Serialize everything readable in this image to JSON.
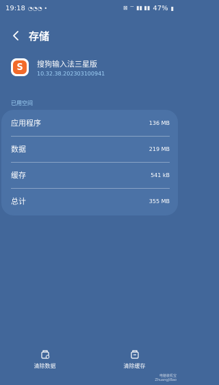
{
  "status_bar": {
    "time": "19:18",
    "battery": "47%"
  },
  "header": {
    "title": "存储"
  },
  "app": {
    "name": "搜狗输入法三星版",
    "version": "10.32.38.202303100941",
    "icon_letter": "S"
  },
  "section": {
    "label": "已用空间"
  },
  "storage": {
    "rows": [
      {
        "label": "应用程序",
        "value": "136 MB"
      },
      {
        "label": "数据",
        "value": "219 MB"
      },
      {
        "label": "缓存",
        "value": "541 kB"
      },
      {
        "label": "总计",
        "value": "355 MB"
      }
    ]
  },
  "actions": {
    "clear_data": "清除数据",
    "clear_cache": "清除缓存"
  },
  "watermark": {
    "line1": "电脑装机宝",
    "line2": "ZhuangJiBao"
  },
  "colors": {
    "background": "#42679a",
    "card": "#4b72a6",
    "accent": "#9fd0f5",
    "app_icon": "#f26a2a"
  }
}
